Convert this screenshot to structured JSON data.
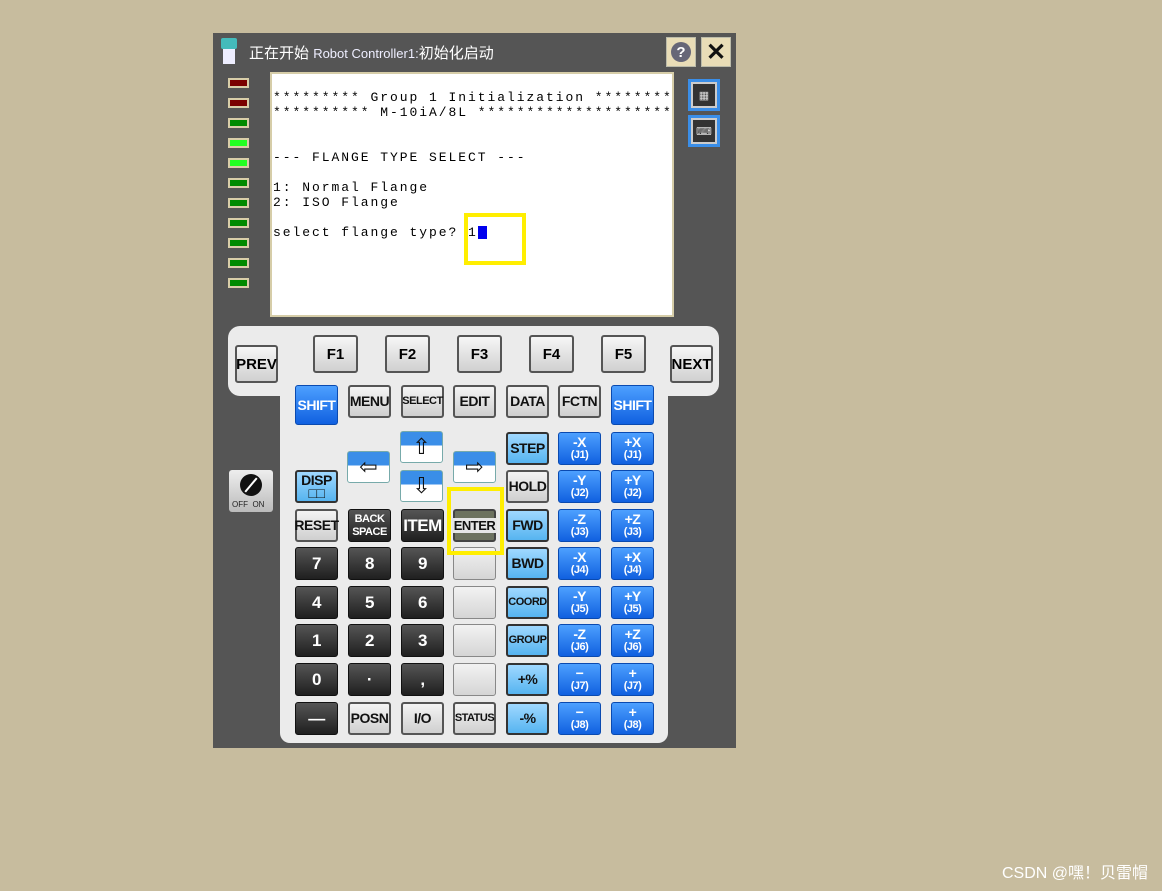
{
  "window": {
    "title_cn_prefix": "正在开始",
    "title_en": "Robot Controller1:",
    "title_cn_suffix": "初始化启动",
    "help_label": "?",
    "close_label": "✕"
  },
  "leds": [
    "#7a0000",
    "#7a0000",
    "#008a00",
    "#22ff22",
    "#22ff22",
    "#008a00",
    "#008a00",
    "#008a00",
    "#008a00",
    "#008a00",
    "#008a00"
  ],
  "screen": {
    "lines": [
      "********* Group 1 Initialization ********",
      "********** M-10iA/8L ********************",
      "--- FLANGE TYPE SELECT ---",
      "1: Normal Flange",
      "2: ISO Flange",
      "select flange type? "
    ],
    "input_value": "1",
    "cursor_color": "#0000ee"
  },
  "highlight_color": "#ffee00",
  "side_icons": [
    "teach-pendant-icon",
    "keyboard-icon"
  ],
  "function_keys": {
    "prev": "PREV",
    "next": "NEXT",
    "f": [
      "F1",
      "F2",
      "F3",
      "F4",
      "F5"
    ]
  },
  "arrows": {
    "left": "⇦",
    "up": "⇧",
    "down": "⇩",
    "right": "⇨"
  },
  "keyswitch": {
    "off": "OFF",
    "on": "ON"
  },
  "keypad": {
    "rows": [
      [
        {
          "l": "SHIFT",
          "s": "blue shift"
        },
        {
          "l": "MENU",
          "s": "gray"
        },
        {
          "l": "SELECT",
          "s": "gray small"
        },
        {
          "l": "EDIT",
          "s": "gray"
        },
        {
          "l": "DATA",
          "s": "gray"
        },
        {
          "l": "FCTN",
          "s": "gray"
        },
        {
          "l": "SHIFT",
          "s": "blue shift"
        }
      ],
      [
        null,
        null,
        null,
        null,
        {
          "l": "STEP",
          "s": "lblue"
        },
        {
          "l": "-X",
          "sub": "(J1)",
          "s": "blue jog"
        },
        {
          "l": "+X",
          "sub": "(J1)",
          "s": "blue jog"
        }
      ],
      [
        {
          "l": "DISP",
          "sub": "□□",
          "s": "lblue"
        },
        null,
        null,
        null,
        {
          "l": "HOLD",
          "s": "gray"
        },
        {
          "l": "-Y",
          "sub": "(J2)",
          "s": "blue jog"
        },
        {
          "l": "+Y",
          "sub": "(J2)",
          "s": "blue jog"
        }
      ],
      [
        {
          "l": "RESET",
          "s": "gray"
        },
        {
          "l": "BACK",
          "sub": "SPACE",
          "s": "dark small"
        },
        {
          "l": "ITEM",
          "s": "dark"
        },
        {
          "l": "ENTER",
          "s": "enter"
        },
        {
          "l": "FWD",
          "s": "lblue"
        },
        {
          "l": "-Z",
          "sub": "(J3)",
          "s": "blue jog"
        },
        {
          "l": "+Z",
          "sub": "(J3)",
          "s": "blue jog"
        }
      ],
      [
        {
          "l": "7",
          "s": "dark"
        },
        {
          "l": "8",
          "s": "dark"
        },
        {
          "l": "9",
          "s": "dark"
        },
        {
          "l": "",
          "s": "blank"
        },
        {
          "l": "BWD",
          "s": "lblue"
        },
        {
          "l": "-X",
          "sub": "(J4)",
          "s": "blue jog"
        },
        {
          "l": "+X",
          "sub": "(J4)",
          "s": "blue jog"
        }
      ],
      [
        {
          "l": "4",
          "s": "dark"
        },
        {
          "l": "5",
          "s": "dark"
        },
        {
          "l": "6",
          "s": "dark"
        },
        {
          "l": "",
          "s": "blank"
        },
        {
          "l": "COORD",
          "s": "lblue small"
        },
        {
          "l": "-Y",
          "sub": "(J5)",
          "s": "blue jog"
        },
        {
          "l": "+Y",
          "sub": "(J5)",
          "s": "blue jog"
        }
      ],
      [
        {
          "l": "1",
          "s": "dark"
        },
        {
          "l": "2",
          "s": "dark"
        },
        {
          "l": "3",
          "s": "dark"
        },
        {
          "l": "",
          "s": "blank"
        },
        {
          "l": "GROUP",
          "s": "lblue small"
        },
        {
          "l": "-Z",
          "sub": "(J6)",
          "s": "blue jog"
        },
        {
          "l": "+Z",
          "sub": "(J6)",
          "s": "blue jog"
        }
      ],
      [
        {
          "l": "0",
          "s": "dark"
        },
        {
          "l": "·",
          "s": "dark"
        },
        {
          "l": ",",
          "s": "dark"
        },
        {
          "l": "",
          "s": "blank"
        },
        {
          "l": "+%",
          "s": "lblue"
        },
        {
          "l": "−",
          "sub": "(J7)",
          "s": "blue jog"
        },
        {
          "l": "+",
          "sub": "(J7)",
          "s": "blue jog"
        }
      ],
      [
        {
          "l": "—",
          "s": "dark"
        },
        {
          "l": "POSN",
          "s": "gray"
        },
        {
          "l": "I/O",
          "s": "gray"
        },
        {
          "l": "STATUS",
          "s": "gray small"
        },
        {
          "l": "-%",
          "s": "lblue"
        },
        {
          "l": "−",
          "sub": "(J8)",
          "s": "blue jog"
        },
        {
          "l": "+",
          "sub": "(J8)",
          "s": "blue jog"
        }
      ]
    ]
  },
  "watermark": "CSDN @嘿！贝雷帽"
}
